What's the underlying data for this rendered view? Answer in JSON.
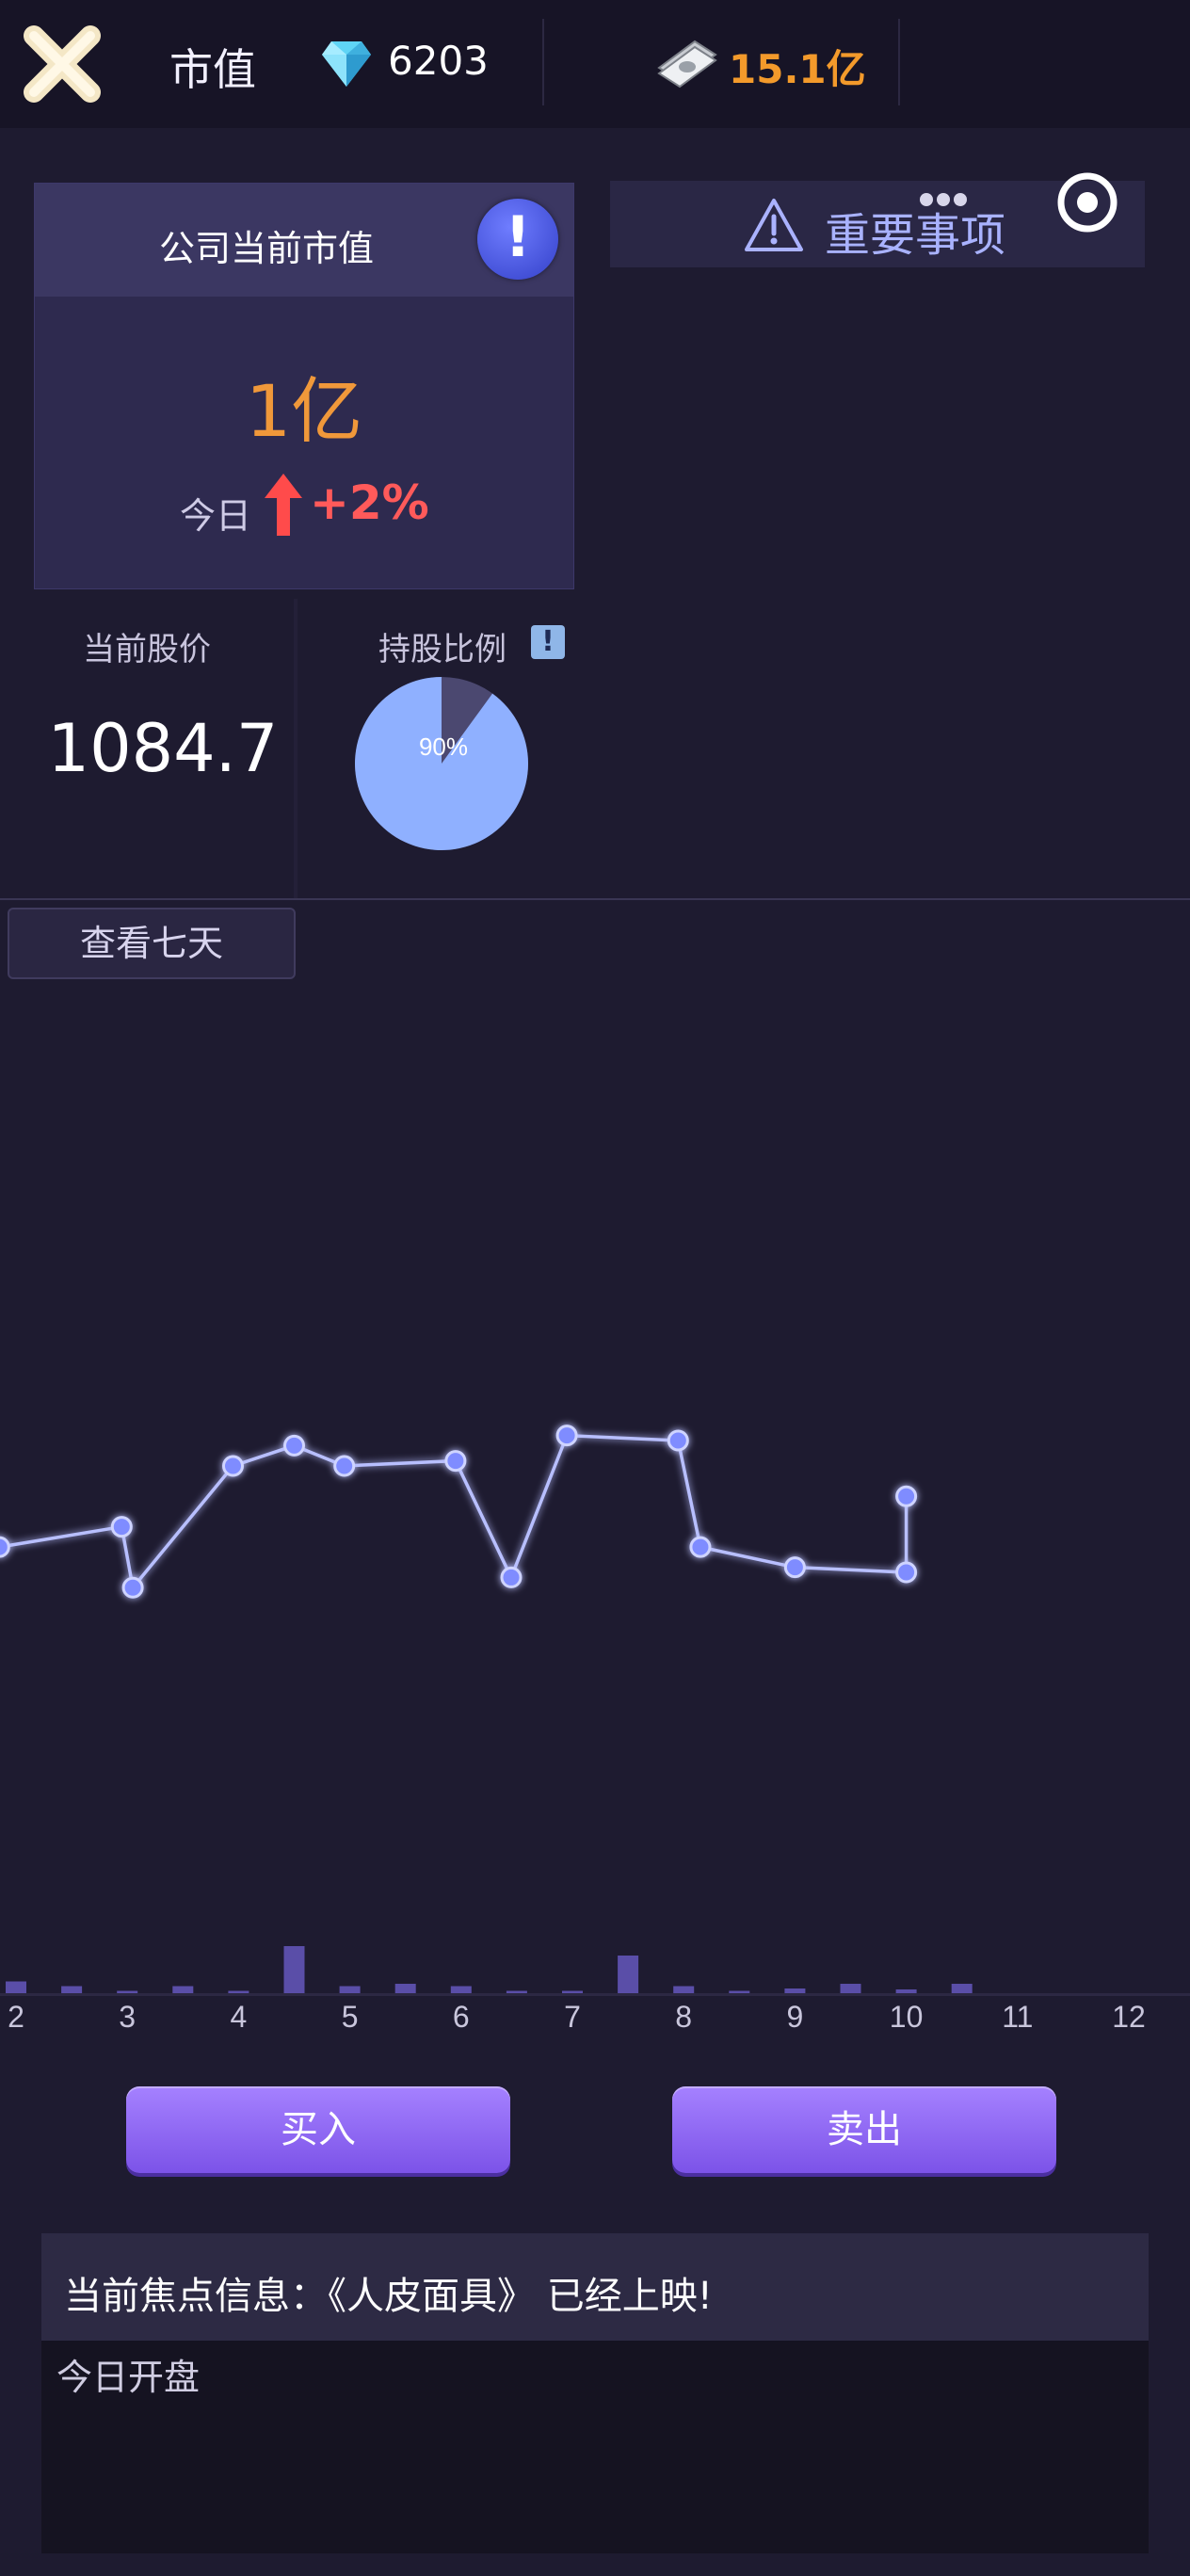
{
  "header": {
    "title": "市值",
    "gems": "6203",
    "money": "15.1亿"
  },
  "market_value_card": {
    "title": "公司当前市值",
    "info_glyph": "!",
    "value": "1亿",
    "today_label": "今日",
    "today_change": "+2%"
  },
  "important": {
    "label": "重要事项"
  },
  "stock": {
    "price_label": "当前股价",
    "price": "1084.7",
    "holding_label": "持股比例",
    "holding_info_glyph": "!",
    "holding_percent_text": "90%",
    "holding_fraction": 0.9
  },
  "chart_controls": {
    "week_button": "查看七天"
  },
  "chart_data": {
    "type": "line",
    "x_tick_labels": [
      "2",
      "3",
      "4",
      "5",
      "6",
      "7",
      "8",
      "9",
      "10",
      "11",
      "12"
    ],
    "x": [
      1.55,
      1.85,
      2.95,
      3.05,
      3.95,
      4.5,
      4.95,
      5.95,
      6.45,
      6.95,
      7.95,
      8.15,
      9.0,
      10.0,
      10.0
    ],
    "values": [
      46,
      44,
      46,
      40,
      52,
      54,
      52,
      52.5,
      41,
      55,
      54.5,
      44,
      42,
      41.5,
      49
    ],
    "volume_x": [
      2,
      2.5,
      3,
      3.5,
      4,
      4.5,
      5,
      5.5,
      6,
      6.5,
      7,
      7.5,
      8,
      8.5,
      9,
      9.5,
      10,
      10.5
    ],
    "volume": [
      2.5,
      1.5,
      0.5,
      1.5,
      0.5,
      10,
      1.5,
      2,
      1.5,
      0.5,
      0.5,
      8,
      1.5,
      0.5,
      1,
      2,
      0.8,
      2
    ],
    "xlim": [
      1.5,
      12.5
    ],
    "ylim": [
      0,
      100
    ],
    "line_color": "#b8bfff",
    "point_color": "#7f8cff",
    "bar_color": "#5a4ea8"
  },
  "actions": {
    "buy": "买入",
    "sell": "卖出"
  },
  "info_panel": {
    "focus_text": "当前焦点信息：《人皮面具》 已经上映!",
    "log_text": "今日开盘"
  },
  "colors": {
    "accent_orange": "#f0983a",
    "up_red": "#ff5a5a",
    "purple_button": "#8d63f2",
    "pie_main": "#8fb0ff",
    "pie_remainder": "#4b4870"
  }
}
